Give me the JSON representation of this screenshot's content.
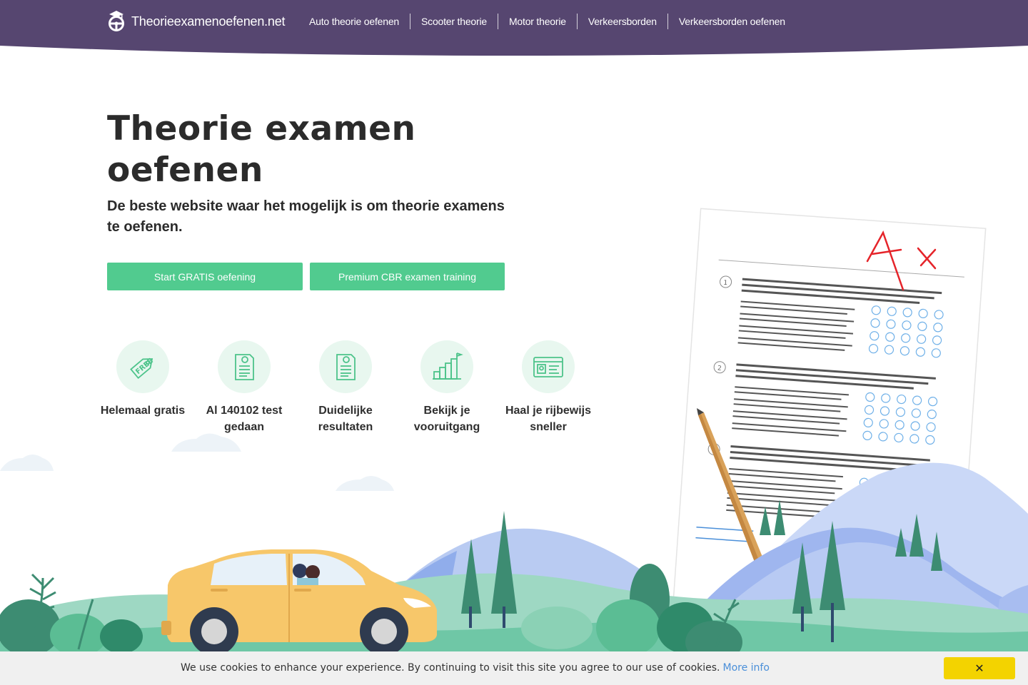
{
  "header": {
    "brand": "Theorieexamenoefenen.net",
    "nav": [
      "Auto theorie oefenen",
      "Scooter theorie",
      "Motor theorie",
      "Verkeersborden",
      "Verkeersborden oefenen"
    ]
  },
  "hero": {
    "title": "Theorie examen oefenen",
    "subtitle": "De beste website waar het mogelijk is om theorie examens te oefenen.",
    "button_free": "Start GRATIS oefening",
    "button_premium": "Premium CBR examen training"
  },
  "features": [
    {
      "label": "Helemaal gratis",
      "icon": "free-tag-icon"
    },
    {
      "label": "Al 140102 test gedaan",
      "icon": "test-document-icon"
    },
    {
      "label": "Duidelijke resultaten",
      "icon": "results-document-icon"
    },
    {
      "label": "Bekijk je vooruitgang",
      "icon": "progress-stairs-icon"
    },
    {
      "label": "Haal je rijbewijs sneller",
      "icon": "license-card-icon"
    }
  ],
  "illustration": {
    "exam_grade": "A+",
    "question_numbers": [
      "1",
      "2",
      "3"
    ],
    "sheet_text": "Lorem ipsum dolor sit amet, consectetuer adipiscing elit, sed diam nonummy nibh euismod tincidunt ut laoreet dolore magna aliquam erat volutpat. Lorem ipsum dolor sit amet, consectetuer adipiscing elit, sed diam nonummy nibh euismod tincidunt.",
    "sheet_small_text": "Lorem ipsum dolor sit amet ipsum, consectetuer adipiscing elit.",
    "sheet_footer": "Lorem"
  },
  "cookie": {
    "text": "We use cookies to enhance your experience. By continuing to visit this site you agree to our use of cookies.",
    "link": "More info",
    "close": "✕"
  },
  "colors": {
    "header": "#564670",
    "accent": "#51cb8f",
    "cookie_button": "#f3d300"
  }
}
